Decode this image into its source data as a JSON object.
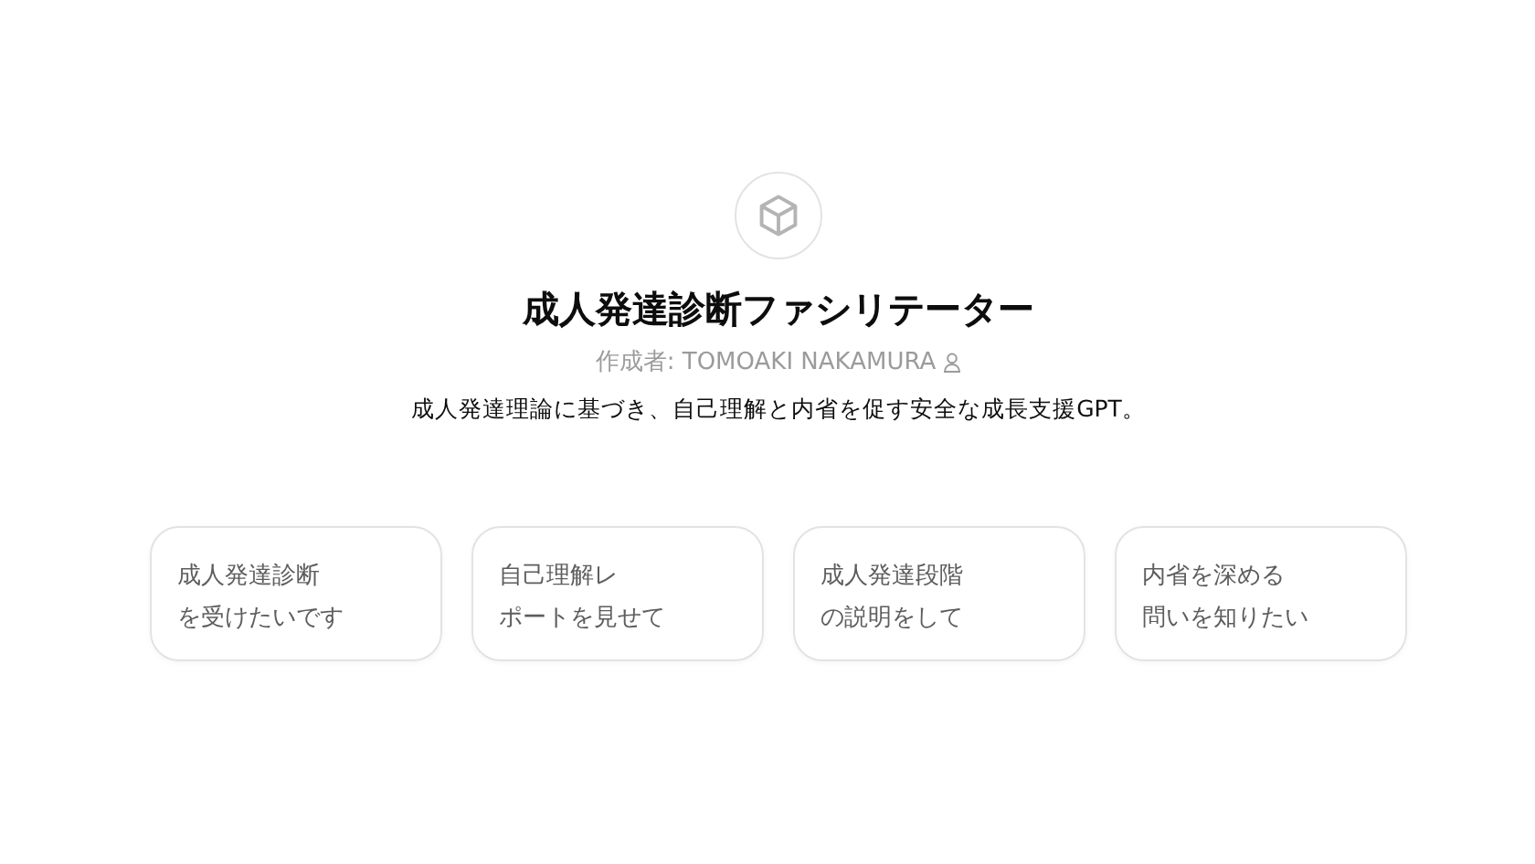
{
  "gpt": {
    "title": "成人発達診断ファシリテーター",
    "author_label": "作成者: TOMOAKI NAKAMURA",
    "description": "成人発達理論に基づき、自己理解と内省を促す安全な成長支援GPT。"
  },
  "suggestions": [
    {
      "lines": [
        "成人発達診断",
        "を受けたいです"
      ]
    },
    {
      "lines": [
        "自己理解レ",
        "ポートを見せて"
      ]
    },
    {
      "lines": [
        "成人発達段階",
        "の説明をして"
      ]
    },
    {
      "lines": [
        "内省を深める",
        "問いを知りたい"
      ]
    }
  ]
}
